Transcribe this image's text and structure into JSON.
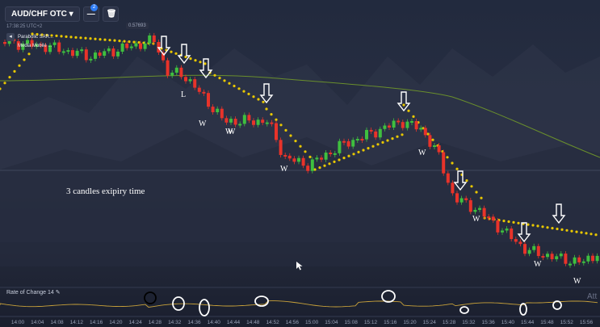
{
  "toolbar": {
    "asset_label": "AUD/CHF OTC",
    "asset_arrow": "▾",
    "menu_icon": "—",
    "trash_icon": "🗑",
    "badge_count": "2"
  },
  "clock": "17:38:25 UTC+2",
  "price_marker": "0.57693",
  "legend": {
    "collapse_icon": "◂",
    "items": [
      "Parabolic SAR...",
      "Media Mobile ..."
    ]
  },
  "annotation_note": "3 candles exipiry time",
  "roc_label": "Rate of Change  14",
  "roc_edit_icon": "✎",
  "watermark": "Att",
  "x_ticks": [
    "14:00",
    "14:04",
    "14:08",
    "14:12",
    "14:16",
    "14:20",
    "14:24",
    "14:28",
    "14:32",
    "14:36",
    "14:40",
    "14:44",
    "14:48",
    "14:52",
    "14:56",
    "15:00",
    "15:04",
    "15:08",
    "15:12",
    "15:16",
    "15:20",
    "15:24",
    "15:28",
    "15:32",
    "15:36",
    "15:40",
    "15:44",
    "15:48",
    "15:52",
    "15:56"
  ],
  "markers": {
    "labels": [
      "L",
      "W",
      "W",
      "W",
      "W",
      "W",
      "W",
      "W",
      "W"
    ]
  },
  "colors": {
    "up": "#3fbf3f",
    "down": "#e8332a",
    "sar": "#e8c700",
    "ma": "#6a8f2c",
    "roc": "#c9a23a",
    "arrow": "#ffffff"
  }
}
